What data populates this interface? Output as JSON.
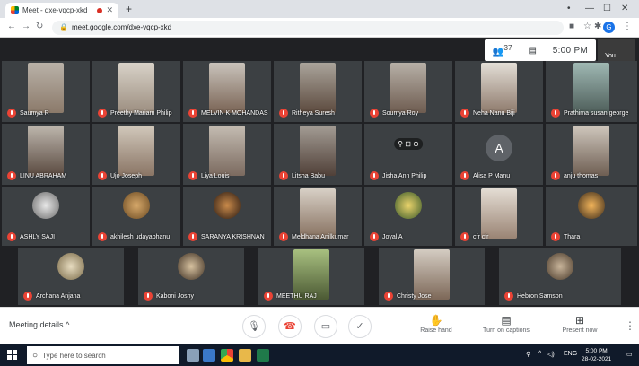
{
  "browser": {
    "tab_title": "Meet - dxe-vqcp-xkd",
    "new_tab": "+",
    "url": "meet.google.com/dxe-vqcp-xkd",
    "window_controls": [
      "•",
      "—",
      "☐",
      "✕"
    ]
  },
  "meet": {
    "participant_count": "37",
    "clock": "5:00 PM",
    "self_label": "You"
  },
  "participants": [
    {
      "name": "Saumya R",
      "tile": "video"
    },
    {
      "name": "Preethy Mariam Philip",
      "tile": "video"
    },
    {
      "name": "MELVIN K MOHANDAS",
      "tile": "video"
    },
    {
      "name": "Ritheya Suresh",
      "tile": "video"
    },
    {
      "name": "Soumya Roy",
      "tile": "video"
    },
    {
      "name": "Neha Nanu Biji",
      "tile": "video"
    },
    {
      "name": "Prathima susan george",
      "tile": "video"
    },
    {
      "name": "LINU ABRAHAM",
      "tile": "video"
    },
    {
      "name": "Ujo Joseph",
      "tile": "video"
    },
    {
      "name": "Liya Louis",
      "tile": "video"
    },
    {
      "name": "Litsha Babu",
      "tile": "video"
    },
    {
      "name": "Jisha Ann Philip",
      "tile": "hover"
    },
    {
      "name": "Alisa P Manu",
      "tile": "avatar",
      "initial": "A"
    },
    {
      "name": "anju thomas",
      "tile": "video"
    },
    {
      "name": "ASHLY SAJI",
      "tile": "photo"
    },
    {
      "name": "akhilesh udayabhanu",
      "tile": "photo"
    },
    {
      "name": "SARANYA KRISHNAN",
      "tile": "photo"
    },
    {
      "name": "Meldhana Anilkumar",
      "tile": "video"
    },
    {
      "name": "Joyal A",
      "tile": "photo"
    },
    {
      "name": "cfr cfr",
      "tile": "video"
    },
    {
      "name": "Thara",
      "tile": "photo"
    },
    {
      "name": "Archana Anjana",
      "tile": "photo"
    },
    {
      "name": "Kaboni Joshy",
      "tile": "photo"
    },
    {
      "name": "MEETHU RAJ",
      "tile": "video"
    },
    {
      "name": "Christy Jose",
      "tile": "video"
    },
    {
      "name": "Hebron Samson",
      "tile": "photo"
    }
  ],
  "controls": {
    "meeting_details": "Meeting details",
    "raise_hand": "Raise hand",
    "captions": "Turn on captions",
    "present": "Present now"
  },
  "taskbar": {
    "search_placeholder": "Type here to search",
    "time": "5:00 PM",
    "date": "28-02-2021",
    "lang": "ENG"
  },
  "colors": {
    "meet_bg": "#202124",
    "tile_bg": "#3c4043",
    "mic_off": "#ea4335",
    "taskbar": "#101a2a"
  }
}
